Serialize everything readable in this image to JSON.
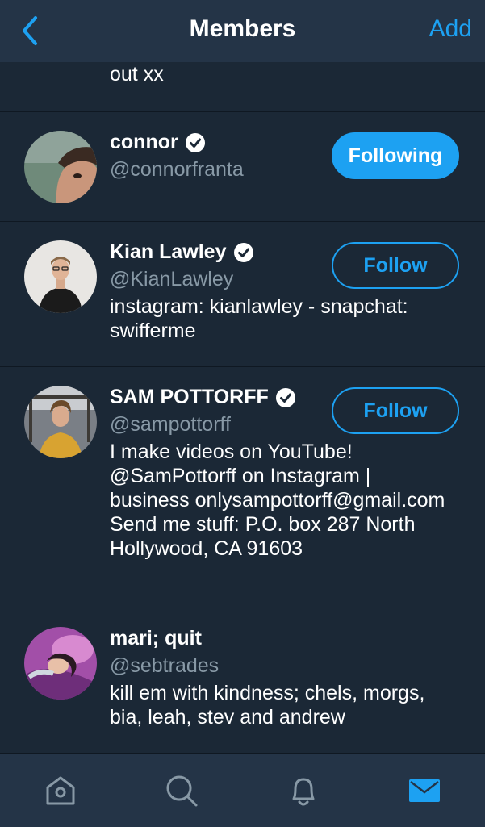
{
  "header": {
    "title": "Members",
    "add_label": "Add",
    "back_icon": "chevron-left-icon"
  },
  "partial_row": {
    "bio_tail": "out xx"
  },
  "members": [
    {
      "name": "connor",
      "handle": "@connorfranta",
      "verified": true,
      "bio": "",
      "button": "Following"
    },
    {
      "name": "Kian Lawley",
      "handle": "@KianLawley",
      "verified": true,
      "bio": "instagram: kianlawley - snapchat: swifferme",
      "button": "Follow"
    },
    {
      "name": "SAM POTTORFF",
      "handle": "@sampottorff",
      "verified": true,
      "bio": "I make videos on YouTube! @SamPottorff on Instagram | business onlysampottorff@gmail.com Send me stuff: P.O. box 287 North Hollywood, CA 91603",
      "button": "Follow"
    },
    {
      "name": "mari; quit",
      "handle": "@sebtrades",
      "verified": false,
      "bio": "kill em with kindness; chels, morgs, bia, leah, stev and andrew",
      "button": ""
    }
  ],
  "tabbar": {
    "items": [
      "home-icon",
      "search-icon",
      "notifications-bell-icon",
      "messages-envelope-icon"
    ],
    "active": "messages-envelope-icon"
  },
  "colors": {
    "background": "#1b2836",
    "bar": "#243447",
    "accent": "#1da1f2",
    "secondary_text": "#8899a6",
    "inactive_icon": "#8899a6"
  }
}
